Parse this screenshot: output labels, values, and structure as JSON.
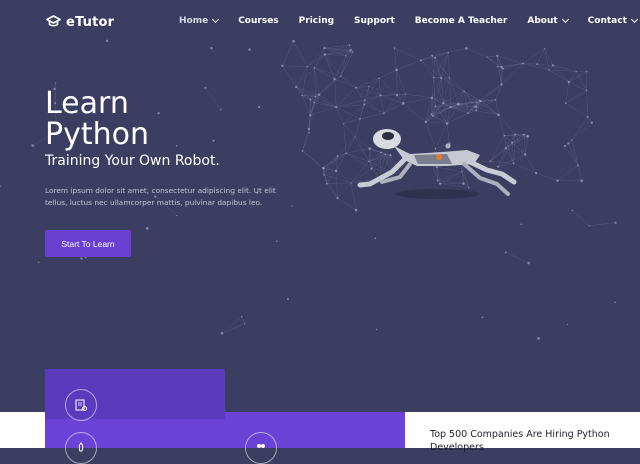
{
  "brand": {
    "name": "eTutor",
    "logo_icon": "graduation-cap-icon"
  },
  "nav": {
    "items": [
      {
        "label": "Home",
        "has_dropdown": true,
        "active": true
      },
      {
        "label": "Courses",
        "has_dropdown": false
      },
      {
        "label": "Pricing",
        "has_dropdown": false
      },
      {
        "label": "Support",
        "has_dropdown": false
      },
      {
        "label": "Become A Teacher",
        "has_dropdown": false
      },
      {
        "label": "About",
        "has_dropdown": true
      },
      {
        "label": "Contact",
        "has_dropdown": true
      }
    ]
  },
  "hero": {
    "title_line1": "Learn",
    "title_line2": "Python",
    "subtitle": "Training Your Own Robot.",
    "description": "Lorem ipsum dolor sit amet, consectetur adipiscing elit. Ut elit tellus, luctus nec ullamcorper mattis, pulvinar dapibus leo.",
    "cta_label": "Start To Learn",
    "illustration": "robot-dog-illustration"
  },
  "features": {
    "card_icons": [
      "certificate-icon",
      "rocket-icon",
      "users-icon"
    ],
    "hiring_text": "Top 500 Companies Are Hiring Python Developers"
  },
  "colors": {
    "background": "#3b3e60",
    "accent": "#6b3fd1",
    "card": "#5a3bbd",
    "band": "#6a42d6"
  }
}
